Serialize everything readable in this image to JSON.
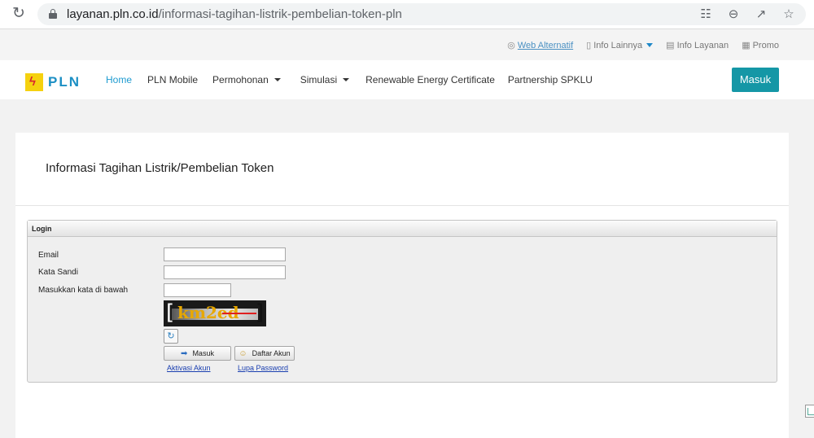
{
  "browser": {
    "url_host": "layanan.pln.co.id",
    "url_path": "/informasi-tagihan-listrik-pembelian-token-pln"
  },
  "utility": {
    "items": [
      {
        "label": "Web Alternatif",
        "icon": "globe-icon"
      },
      {
        "label": "Info Lainnya",
        "icon": "document-icon"
      },
      {
        "label": "Info Layanan",
        "icon": "clipboard-icon"
      },
      {
        "label": "Promo",
        "icon": "gift-icon"
      }
    ]
  },
  "nav": {
    "logo_text": "PLN",
    "links": [
      {
        "label": "Home",
        "active": true
      },
      {
        "label": "PLN Mobile"
      },
      {
        "label": "Permohonan",
        "dropdown": true
      },
      {
        "label": "Simulasi",
        "dropdown": true
      },
      {
        "label": "Renewable Energy Certificate"
      },
      {
        "label": "Partnership SPKLU"
      }
    ],
    "login_button": "Masuk"
  },
  "card": {
    "title": "Informasi Tagihan Listrik/Pembelian Token"
  },
  "login": {
    "header": "Login",
    "email_label": "Email",
    "email_value": "",
    "password_label": "Kata Sandi",
    "password_value": "",
    "captcha_label": "Masukkan kata di bawah",
    "captcha_value": "",
    "captcha_text": "km2ed",
    "submit_label": "Masuk",
    "register_label": "Daftar Akun",
    "activate_link": "Aktivasi Akun",
    "forgot_link": "Lupa Password"
  },
  "colors": {
    "accent": "#1597a6",
    "brand_blue": "#1c8fc4",
    "brand_yellow": "#f5d10f",
    "link": "#1a3fb0"
  }
}
